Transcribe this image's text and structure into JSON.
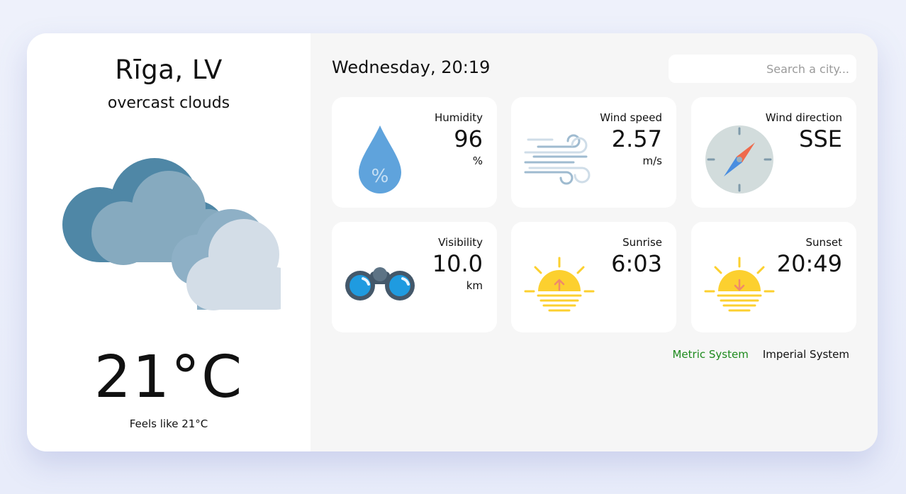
{
  "location": {
    "city": "Rīga, LV",
    "description": "overcast clouds",
    "temperature": "21°C",
    "feels_like": "Feels like 21°C",
    "weather_icon": "overcast-clouds-icon"
  },
  "header": {
    "datetime": "Wednesday, 20:19",
    "search_placeholder": "Search a city..."
  },
  "metrics": [
    {
      "label": "Humidity",
      "value": "96",
      "unit": "%",
      "icon": "humidity-drop-icon"
    },
    {
      "label": "Wind speed",
      "value": "2.57",
      "unit": "m/s",
      "icon": "wind-icon"
    },
    {
      "label": "Wind direction",
      "value": "SSE",
      "unit": "",
      "icon": "compass-icon"
    },
    {
      "label": "Visibility",
      "value": "10.0",
      "unit": "km",
      "icon": "binoculars-icon"
    },
    {
      "label": "Sunrise",
      "value": "6:03",
      "unit": "",
      "icon": "sunrise-icon"
    },
    {
      "label": "Sunset",
      "value": "20:49",
      "unit": "",
      "icon": "sunset-icon"
    }
  ],
  "unit_switch": {
    "metric_label": "Metric System",
    "imperial_label": "Imperial System",
    "active": "metric",
    "active_color": "#1d8a1d"
  },
  "colors": {
    "card_background": "#ffffff",
    "panel_background": "#f6f6f6",
    "sun": "#fcd02f",
    "drop": "#5fa3dc"
  }
}
